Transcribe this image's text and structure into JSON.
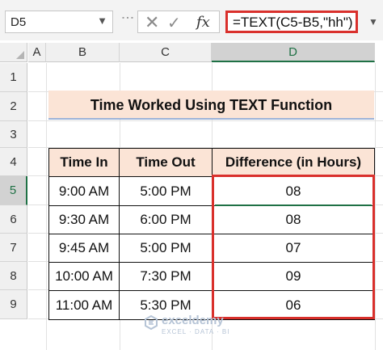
{
  "formula_bar": {
    "name_box": "D5",
    "formula": "=TEXT(C5-B5,\"hh\")",
    "fx_label": "fx",
    "icons": [
      "chevron-down-icon",
      "more-icon",
      "cancel-icon",
      "enter-icon",
      "insert-function-icon"
    ]
  },
  "columns": [
    "A",
    "B",
    "C",
    "D"
  ],
  "rows": [
    "1",
    "2",
    "3",
    "4",
    "5",
    "6",
    "7",
    "8",
    "9"
  ],
  "selected_cell": {
    "column": "D",
    "row": "5"
  },
  "title": "Time Worked Using TEXT Function",
  "table": {
    "headers": [
      "Time In",
      "Time Out",
      "Difference (in Hours)"
    ],
    "rows": [
      [
        "9:00 AM",
        "5:00 PM",
        "08"
      ],
      [
        "9:30 AM",
        "6:00 PM",
        "08"
      ],
      [
        "9:45 AM",
        "5:00 PM",
        "07"
      ],
      [
        "10:00 AM",
        "7:30 PM",
        "09"
      ],
      [
        "11:00 AM",
        "5:30 PM",
        "06"
      ]
    ]
  },
  "watermark": {
    "name": "exceldemy",
    "tagline": "EXCEL · DATA · BI"
  },
  "colors": {
    "highlight_red": "#d9302c",
    "excel_green": "#1f7145",
    "header_fill": "#fbe4d6"
  }
}
